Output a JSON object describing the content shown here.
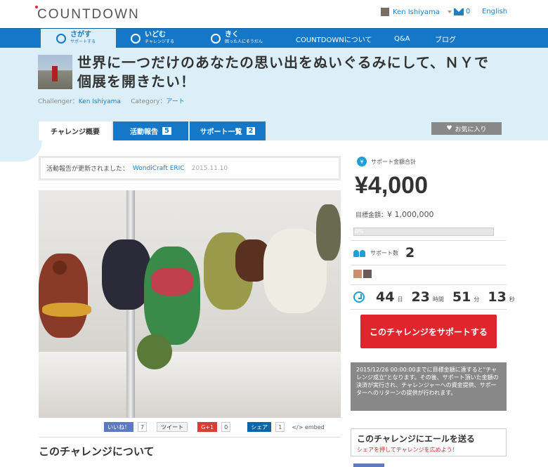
{
  "header": {
    "logo": "COUNTDOWN",
    "user_name": "Ken Ishiyama",
    "mail_count": "0",
    "language": "English"
  },
  "nav": {
    "items": [
      {
        "title": "さがす",
        "sub": "サポートする"
      },
      {
        "title": "いどむ",
        "sub": "チャレンジする"
      },
      {
        "title": "きく",
        "sub": "困った人にそうだん"
      }
    ],
    "links": [
      "COUNTDOWNについて",
      "Q&A",
      "ブログ"
    ]
  },
  "project": {
    "title": "世界に一つだけのあなたの思い出をぬいぐるみにして、ＮＹで個展を開きたい！",
    "challenger_label": "Challenger：",
    "challenger_name": "Ken Ishiyama",
    "category_label": "Category：",
    "category": "アート"
  },
  "tabs": [
    {
      "label": "チャレンジ概要",
      "count": ""
    },
    {
      "label": "活動報告",
      "count": "5"
    },
    {
      "label": "サポート一覧",
      "count": "2"
    }
  ],
  "favorite_label": "お気に入り",
  "notice": {
    "text": "活動報告が更新されました：",
    "author": "WondiCraft ERIC",
    "date": "2015.11.10"
  },
  "share": {
    "like_label": "いいね！",
    "like_count": "7",
    "tweet_label": "ツイート",
    "gplus_label": "G+1",
    "gplus_count": "0",
    "linkedin_label": "シェア",
    "linkedin_count": "1",
    "embed_label": "</> embed"
  },
  "about_heading": "このチャレンジについて",
  "sidebar": {
    "total_label": "サポート金額合計",
    "total_amount": "¥4,000",
    "goal_label": "目標金額：",
    "goal_amount": "¥ 1,000,000",
    "progress_text": "0%",
    "progress_fraction": 0.004,
    "supporters_label": "サポート数",
    "supporters_count": "2",
    "countdown": {
      "days": "44",
      "days_unit": "日",
      "hours": "23",
      "hours_unit": "時間",
      "minutes": "51",
      "minutes_unit": "分",
      "seconds": "13",
      "seconds_unit": "秒"
    },
    "cta_label": "このチャレンジをサポートする",
    "info_text": "2015/12/26 00:00:00までに目標金額に達すると\"チャレンジ成立\"となります。その後、サポート頂いた金額の決済が実行され、チャレンジャーへの資金提供、サポーターへのリターンの提供が行われます。",
    "cheer_title": "このチャレンジにエールを送る",
    "cheer_sub": "シェアを押してチャレンジを広めよう！"
  },
  "colors": {
    "brand_blue": "#1577c8",
    "light_blue": "#dceff9",
    "accent_red": "#e0262c",
    "link_blue": "#1f7fc4"
  }
}
